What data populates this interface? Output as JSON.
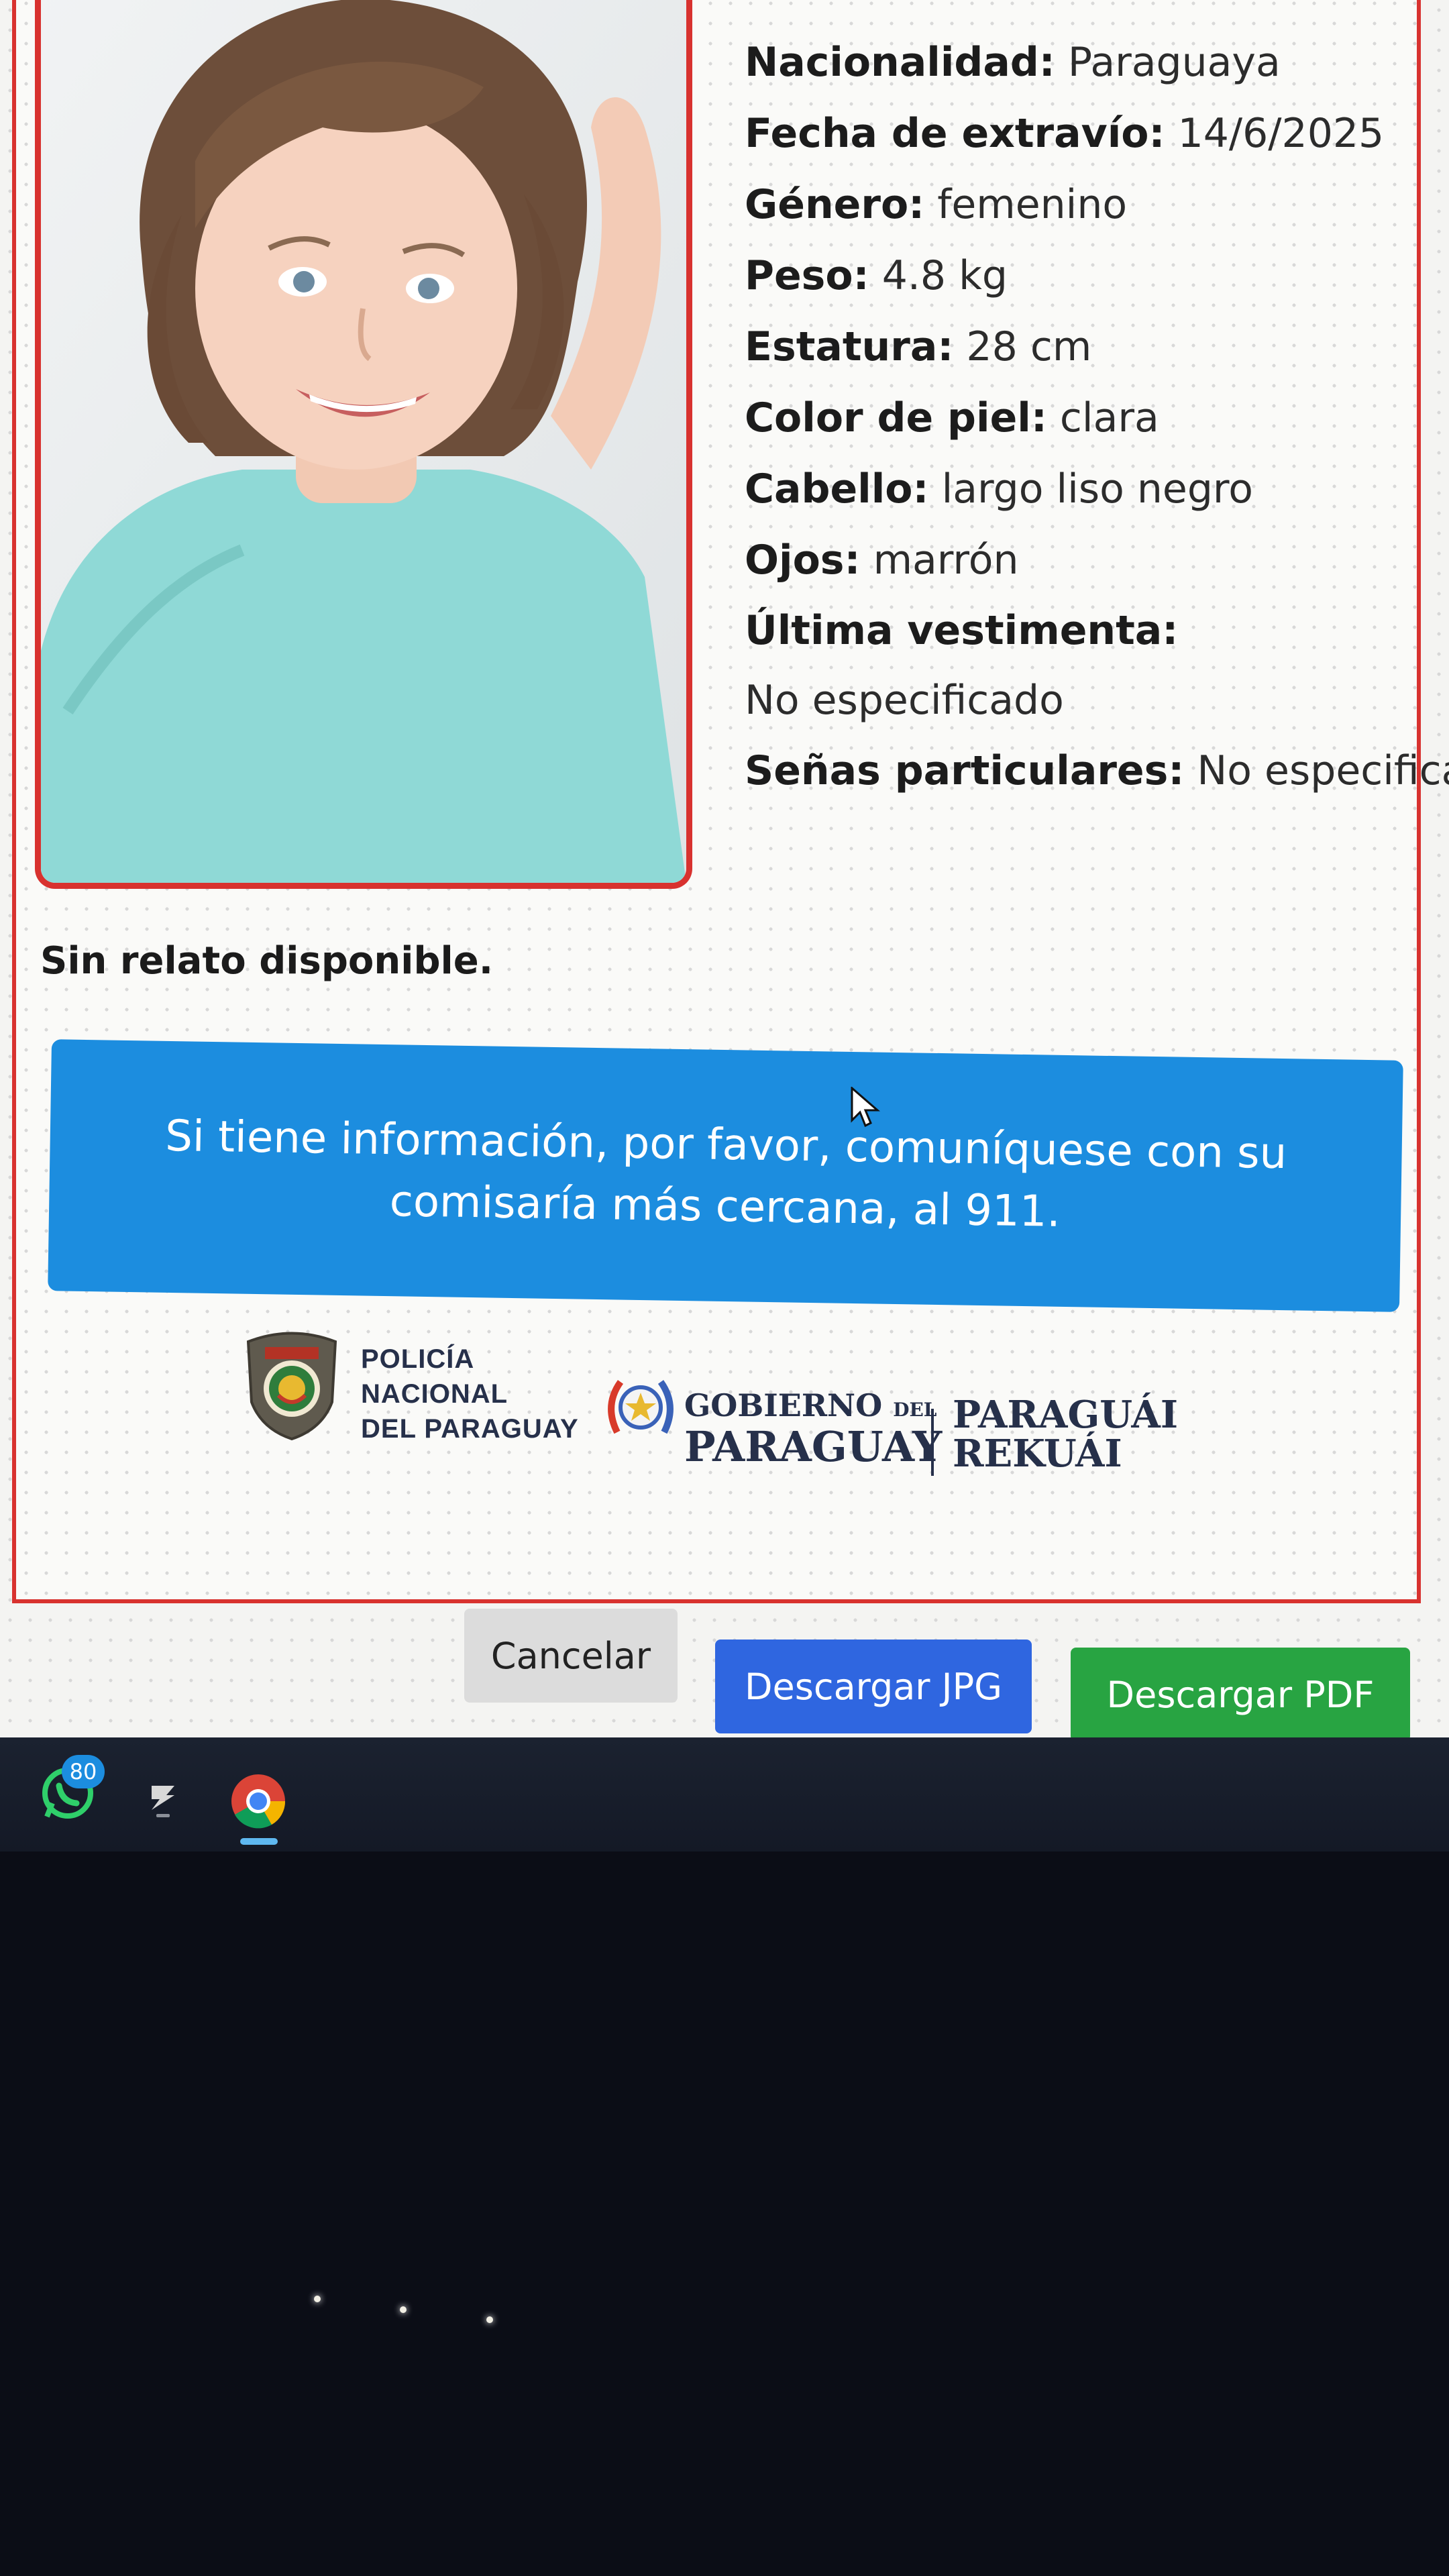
{
  "person": {
    "fields": [
      {
        "label": "Nacionalidad:",
        "value": "Paraguaya"
      },
      {
        "label": "Fecha de extravío:",
        "value": "14/6/2025"
      },
      {
        "label": "Género:",
        "value": "femenino"
      },
      {
        "label": "Peso:",
        "value": "4.8 kg"
      },
      {
        "label": "Estatura:",
        "value": "28 cm"
      },
      {
        "label": "Color de piel:",
        "value": "clara"
      },
      {
        "label": "Cabello:",
        "value": "largo liso negro"
      },
      {
        "label": "Ojos:",
        "value": "marrón"
      },
      {
        "label": "Última vestimenta:",
        "value": "No especificado"
      },
      {
        "label": "Señas particulares:",
        "value": "No especificado"
      }
    ],
    "relato": "Sin relato disponible."
  },
  "banner": {
    "text": "Si tiene información, por favor, comuníquese con su comisaría más cercana, al 911."
  },
  "logos": {
    "policia": [
      "POLICÍA",
      "NACIONAL",
      "DEL PARAGUAY"
    ],
    "gobierno_line1": "GOBIERNO",
    "gobierno_del": "DEL",
    "gobierno_line2": "PARAGUAY",
    "rekuai_line1": "PARAGUÁI",
    "rekuai_line2": "REKUÁI"
  },
  "buttons": {
    "cancel": "Cancelar",
    "jpg": "Descargar JPG",
    "pdf": "Descargar PDF"
  },
  "taskbar": {
    "whatsapp_badge": "80",
    "icons": [
      "whatsapp-icon",
      "app-icon",
      "chrome-icon"
    ]
  },
  "colors": {
    "card_border": "#d8322f",
    "banner": "#1c8ddf",
    "jpg_button": "#2f66e0",
    "pdf_button": "#28a442"
  }
}
